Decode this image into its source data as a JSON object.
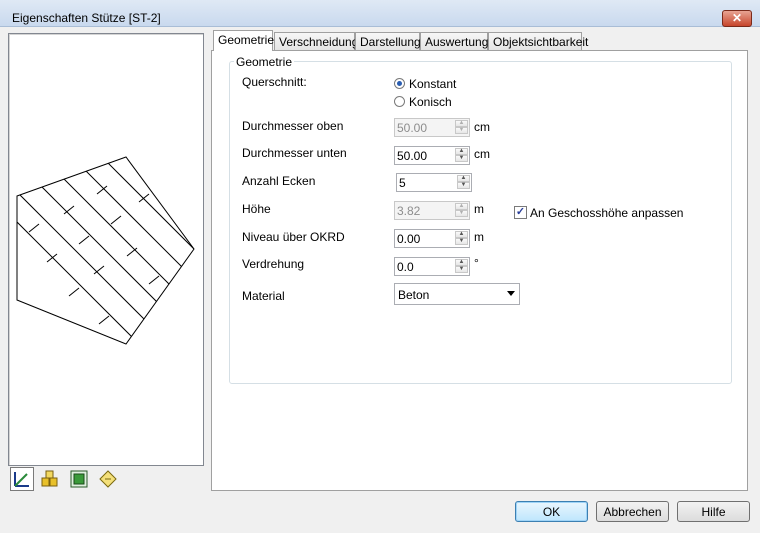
{
  "window": {
    "title": "Eigenschaften Stütze [ST-2]",
    "close_label": "✕"
  },
  "tabs": [
    {
      "label": "Geometrie",
      "active": true
    },
    {
      "label": "Verschneidung",
      "active": false
    },
    {
      "label": "Darstellung",
      "active": false
    },
    {
      "label": "Auswertung",
      "active": false
    },
    {
      "label": "Objektsichtbarkeit",
      "active": false
    }
  ],
  "geometry": {
    "group_title": "Geometrie",
    "querschnitt": {
      "label": "Querschnitt:",
      "options": [
        {
          "label": "Konstant",
          "selected": true
        },
        {
          "label": "Konisch",
          "selected": false
        }
      ]
    },
    "durchmesser_oben": {
      "label": "Durchmesser oben",
      "value": "50.00",
      "unit": "cm",
      "enabled": false
    },
    "durchmesser_unten": {
      "label": "Durchmesser unten",
      "value": "50.00",
      "unit": "cm",
      "enabled": true
    },
    "anzahl_ecken": {
      "label": "Anzahl Ecken",
      "value": "5",
      "unit": "",
      "enabled": true
    },
    "hoehe": {
      "label": "Höhe",
      "value": "3.82",
      "unit": "m",
      "enabled": false
    },
    "geschoss_check": {
      "label": "An Geschosshöhe anpassen",
      "checked": true,
      "mark": "✓"
    },
    "niveau": {
      "label": "Niveau über OKRD",
      "value": "0.00",
      "unit": "m",
      "enabled": true
    },
    "verdrehung": {
      "label": "Verdrehung",
      "value": "0.0",
      "unit": "°",
      "enabled": true
    },
    "material": {
      "label": "Material",
      "value": "Beton"
    }
  },
  "preview_toolbar": [
    {
      "icon": "ruler-icon",
      "active": true
    },
    {
      "icon": "blocks-icon",
      "active": false
    },
    {
      "icon": "layers-icon",
      "active": false
    },
    {
      "icon": "note-icon",
      "active": false
    }
  ],
  "buttons": {
    "ok": "OK",
    "cancel": "Abbrechen",
    "help": "Hilfe"
  },
  "colors": {
    "title_bar": "#c9d9ee",
    "close": "#c7452b",
    "accent": "#3c7fb1"
  }
}
